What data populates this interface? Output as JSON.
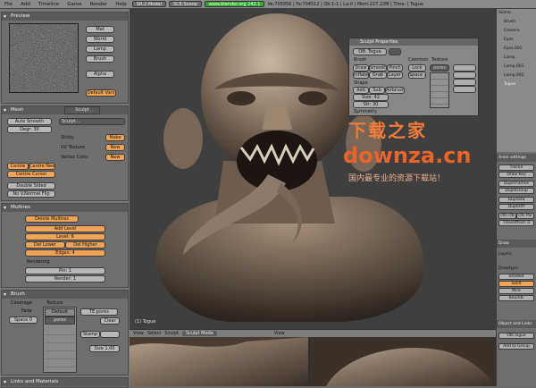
{
  "menubar": {
    "items": [
      "File",
      "Add",
      "Timeline",
      "Game",
      "Render",
      "Help"
    ],
    "screen": "SR:2-Model",
    "scene": "SCE:Scene",
    "url": "www.blender.org 242.1",
    "stats": "Ve:705856 | Fa:704512 | Ob:1-1 | La:0 | Mem:227.22M | Time: | Togue"
  },
  "preview": {
    "title": "Preview",
    "buttons": [
      "Mat",
      "World",
      "Lamp",
      "Brush",
      "Alpha",
      "Default Vars"
    ]
  },
  "mesh": {
    "tab1": "Mesh",
    "tab2": "Sculpt",
    "auto_smooth": "Auto Smooth",
    "degr": "Degr: 30",
    "field": "Sculpt...",
    "sticky": "Sticky",
    "uv_texture": "UV Texture",
    "vertex_color": "Vertex Color",
    "make": "Make",
    "new1": "New",
    "new2": "New",
    "centre": "Centre",
    "centre_new": "Centre New",
    "centre_cursor": "Centre Cursor",
    "double_sided": "Double Sided",
    "no_vnormal_flip": "No V.Normal Flip"
  },
  "multires": {
    "title": "Multires",
    "delete": "Delete Multires",
    "add_level": "Add Level",
    "level": "Level: 6",
    "del_lower": "Del Lower",
    "del_higher": "Del Higher",
    "edges": "Edges: 4",
    "rendering": "Rendering",
    "pin": "Pin: 1",
    "render": "Render: 1"
  },
  "brush": {
    "title": "Brush",
    "coverage": "Coverage",
    "texture": "Texture",
    "fade": "Fade",
    "space": "Space 0",
    "default": "Default",
    "pores": "pores",
    "tex_name": "TE:pores",
    "clear": "Clear",
    "stamp": "Stamp",
    "size": "Size 1.00"
  },
  "links": {
    "title": "Links and Materials"
  },
  "viewport": {
    "label": "(1) Togue"
  },
  "sculpt_dialog": {
    "title": "Sculpt Properties",
    "ob": "OB: Togue",
    "brush": "Brush",
    "common": "Common",
    "texture": "Texture",
    "symmetry": "Symmetry",
    "tools": [
      "Draw",
      "Smooth",
      "Pinch",
      "Inflate",
      "Grab",
      "Layer"
    ],
    "shape": "Shape",
    "add": "Add",
    "sub": "Sub",
    "airbrush": "Airbrush",
    "size": "Size: 42",
    "strength": "Str: 30",
    "lock": "Lock",
    "space_x": "Space X",
    "pores": "pores"
  },
  "footer": {
    "items": [
      "View",
      "Select",
      "Sculpt",
      "Sculpt Mode",
      "View"
    ]
  },
  "right_panel": {
    "outliner_items": [
      "Scene",
      "Brush",
      "Camera",
      "Eyes",
      "Eyes.001",
      "Lamp",
      "Lamp.001",
      "Lamp.002",
      "Togue"
    ],
    "anim_title": "Anim settings",
    "track": "TrackX",
    "draw_key": "Draw Key",
    "dupli_frames": "DupliFrames",
    "dupli_group": "DupliGroup",
    "dupli_sta": "DupliSta",
    "dupli_off": "DupliOff",
    "ofs_ob": "Ofs Ob",
    "ofs_par": "Ofs Par",
    "time_offset": "TimeOffset: 0",
    "draw_title": "Draw",
    "layers": "Layers",
    "drawtype": "Drawtype",
    "drawtypes": [
      "Shaded",
      "Solid",
      "Wire",
      "Bounds"
    ],
    "object_links": "Object and Links",
    "ob_name": "OB:Togue",
    "add_group": "Add to Group"
  },
  "watermark": {
    "cn_title": "下载之家",
    "domain": "downza.cn",
    "cn_sub": "国内最专业的资源下载站！"
  }
}
